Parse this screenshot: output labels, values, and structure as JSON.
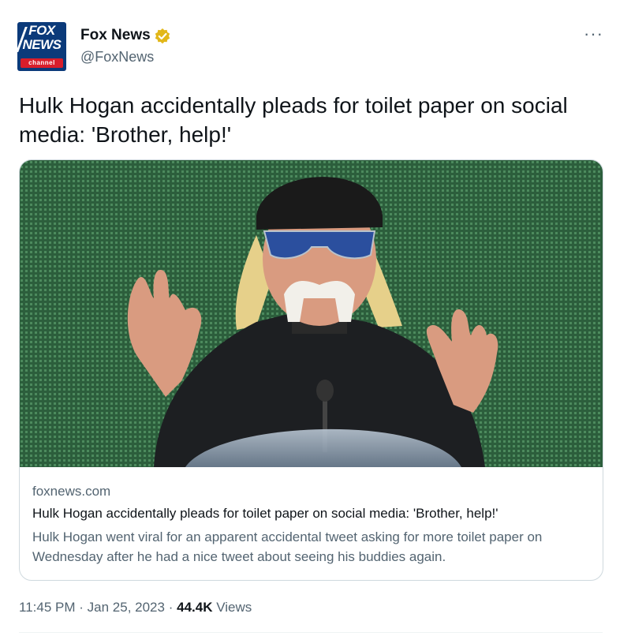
{
  "author": {
    "display_name": "Fox News",
    "handle": "@FoxNews",
    "avatar": {
      "line1": "FOX",
      "line2": "NEWS",
      "line3": "channel",
      "bg_color": "#0b3a7a",
      "accent_color": "#d81e2b"
    },
    "verified_icon": "gold-verified-badge-icon",
    "verified_color": "#e2b719"
  },
  "more_label": "···",
  "tweet": {
    "text": "Hulk Hogan accidentally pleads for toilet paper on social media: 'Brother, help!'"
  },
  "card": {
    "image_subject": "photo-of-speaker-at-podium",
    "domain": "foxnews.com",
    "title": "Hulk Hogan accidentally pleads for toilet paper on social media: 'Brother, help!'",
    "description": "Hulk Hogan went viral for an apparent accidental tweet asking for more toilet paper on Wednesday after he had a nice tweet about seeing his buddies again."
  },
  "meta": {
    "time": "11:45 PM",
    "date": "Jan 25, 2023",
    "separator": "·",
    "views_count": "44.4K",
    "views_label": "Views"
  }
}
